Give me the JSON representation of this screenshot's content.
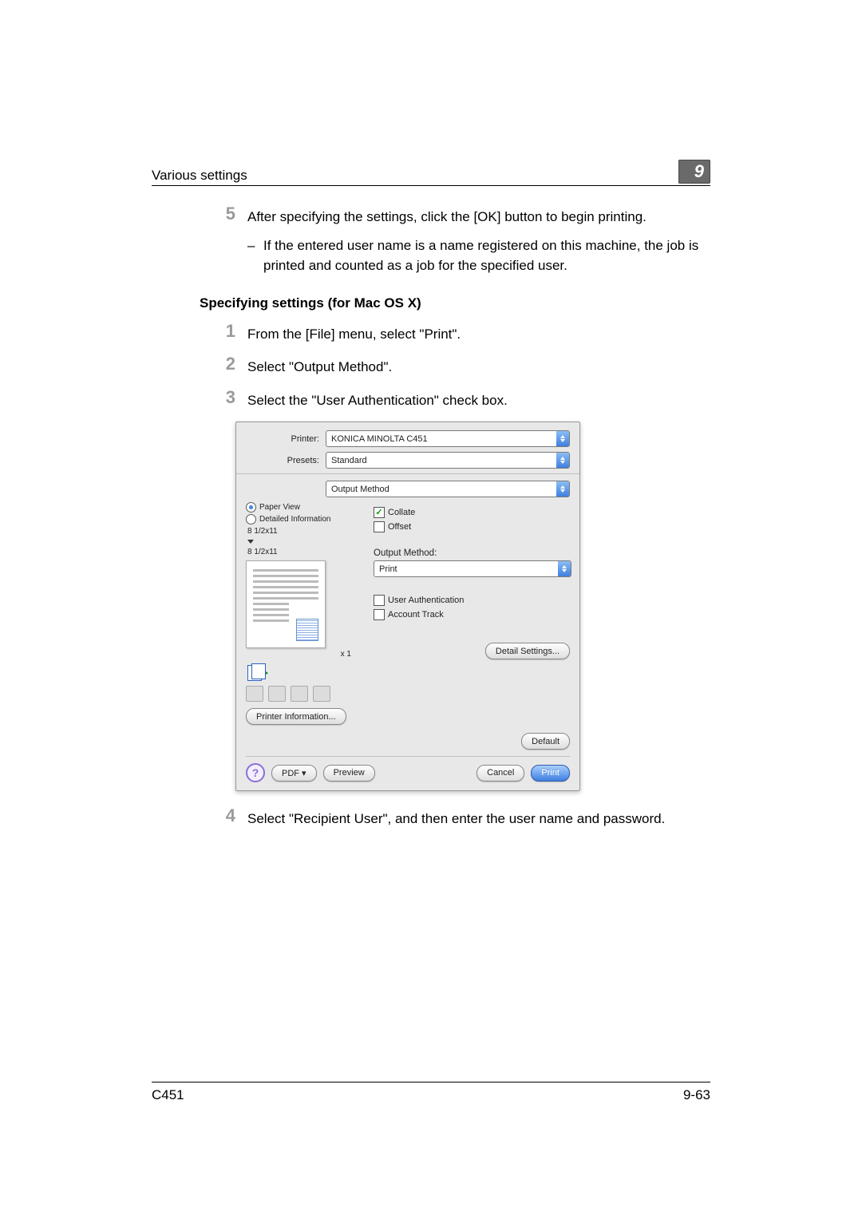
{
  "header": {
    "title": "Various settings",
    "section_number": "9"
  },
  "step5": {
    "num": "5",
    "text": "After specifying the settings, click the [OK] button to begin printing.",
    "sub_dash": "–",
    "sub_text": "If the entered user name is a name registered on this machine, the job is printed and counted as a job for the specified user."
  },
  "subheading": "Specifying settings (for Mac OS X)",
  "mac_steps": {
    "s1_num": "1",
    "s1_text": "From the [File] menu, select \"Print\".",
    "s2_num": "2",
    "s2_text": "Select \"Output Method\".",
    "s3_num": "3",
    "s3_text": "Select the \"User Authentication\" check box."
  },
  "dialog": {
    "printer_label": "Printer:",
    "printer_value": "KONICA MINOLTA C451",
    "presets_label": "Presets:",
    "presets_value": "Standard",
    "panel_value": "Output Method",
    "paper_view": "Paper View",
    "detailed_info": "Detailed Information",
    "size1": "8 1/2x11",
    "size2": "8 1/2x11",
    "x1": "x 1",
    "collate": "Collate",
    "offset": "Offset",
    "output_method_label": "Output Method:",
    "output_method_value": "Print",
    "user_auth": "User Authentication",
    "account_track": "Account Track",
    "printer_info_btn": "Printer Information...",
    "detail_settings_btn": "Detail Settings...",
    "default_btn": "Default",
    "pdf_btn": "PDF ▾",
    "preview_btn": "Preview",
    "cancel_btn": "Cancel",
    "print_btn": "Print",
    "help": "?"
  },
  "step4": {
    "num": "4",
    "text": "Select \"Recipient User\", and then enter the user name and password."
  },
  "footer": {
    "left": "C451",
    "right": "9-63"
  }
}
